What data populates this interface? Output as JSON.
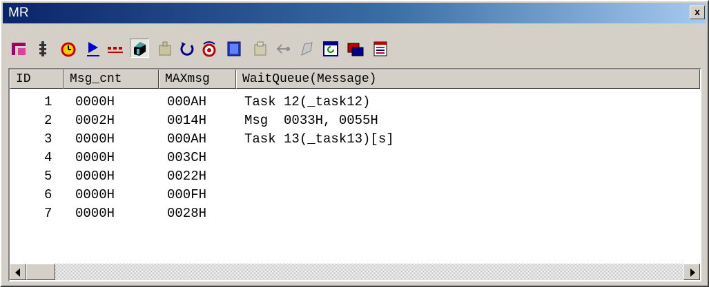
{
  "window": {
    "title": "MR",
    "close_label": "x"
  },
  "toolbar": {
    "icons": [
      "task-icon",
      "sem-icon",
      "alarm-icon",
      "cyclic-icon",
      "dtq-icon",
      "mailbox-icon",
      "mpf-icon",
      "cyclic-handler-icon",
      "interrupt-icon",
      "memory-icon",
      "copy-icon",
      "back-icon",
      "refresh-icon",
      "window-refresh-icon",
      "display-icon",
      "trace-icon"
    ]
  },
  "table": {
    "headers": {
      "id": "ID",
      "msg_cnt": "Msg_cnt",
      "maxmsg": "MAXmsg",
      "waitqueue": "WaitQueue(Message)"
    },
    "rows": [
      {
        "id": "1",
        "msg_cnt": "0000H",
        "maxmsg": "000AH",
        "waitqueue": "Task 12(_task12)"
      },
      {
        "id": "2",
        "msg_cnt": "0002H",
        "maxmsg": "0014H",
        "waitqueue": "Msg  0033H, 0055H"
      },
      {
        "id": "3",
        "msg_cnt": "0000H",
        "maxmsg": "000AH",
        "waitqueue": "Task 13(_task13)[s]"
      },
      {
        "id": "4",
        "msg_cnt": "0000H",
        "maxmsg": "003CH",
        "waitqueue": ""
      },
      {
        "id": "5",
        "msg_cnt": "0000H",
        "maxmsg": "0022H",
        "waitqueue": ""
      },
      {
        "id": "6",
        "msg_cnt": "0000H",
        "maxmsg": "000FH",
        "waitqueue": ""
      },
      {
        "id": "7",
        "msg_cnt": "0000H",
        "maxmsg": "0028H",
        "waitqueue": ""
      }
    ]
  }
}
